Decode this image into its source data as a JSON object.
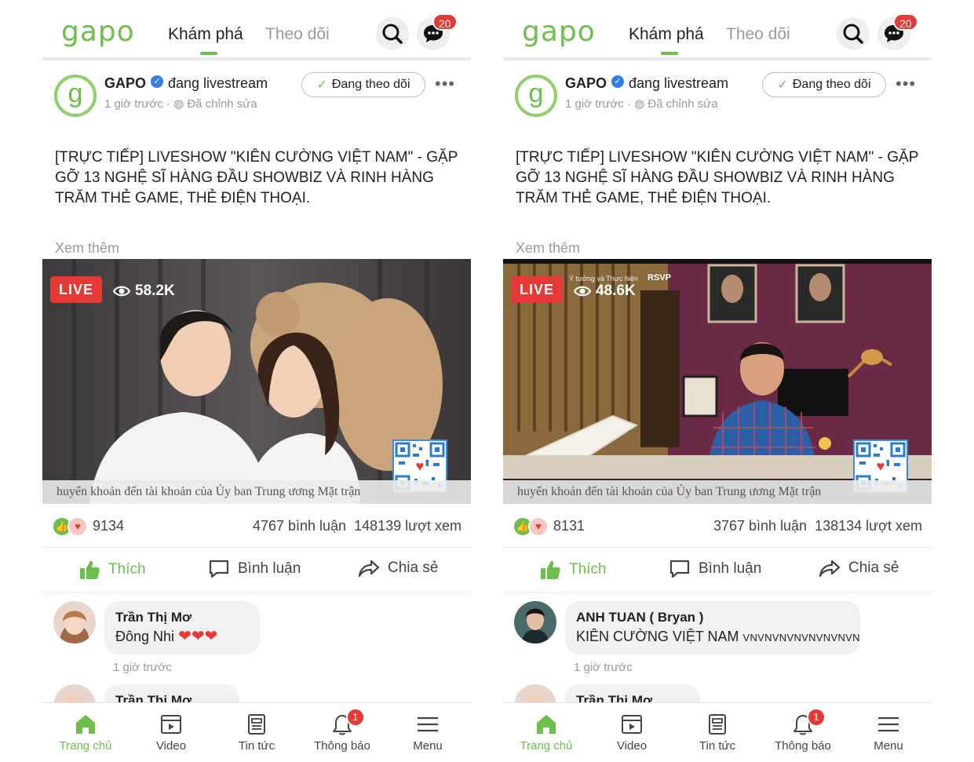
{
  "colors": {
    "brand_green": "#6cc04a",
    "badge_red": "#e53935",
    "muted": "#9a9a9a",
    "verified_blue": "#2f7fe6"
  },
  "screens": [
    {
      "header": {
        "logo": "gapo",
        "tab_active": "Khám phá",
        "tab_inactive": "Theo dõi",
        "chat_badge": "20"
      },
      "post": {
        "author": "GAPO",
        "action": "đang livestream",
        "time": "1 giờ trước · ",
        "edited": "Đã chỉnh sửa",
        "follow_label": "Đang theo dõi",
        "text": "[TRỰC TIẾP] LIVESHOW \"KIÊN CƯỜNG VIỆT NAM\" - GẶP GỠ 13 NGHỆ SĨ HÀNG ĐẦU SHOWBIZ VÀ RINH HÀNG TRĂM THẺ GAME, THẺ ĐIỆN THOẠI.",
        "see_more": "Xem thêm"
      },
      "video": {
        "live_label": "LIVE",
        "viewers": "58.2K",
        "ticker": "huyển khoản đến tài khoản của Ủy ban Trung ương Mặt trận"
      },
      "stats": {
        "likes": "9134",
        "comments": "4767 bình luận",
        "views": "148139 lượt xem"
      },
      "actions": {
        "like": "Thích",
        "comment": "Bình luận",
        "share": "Chia sẻ"
      },
      "comment": {
        "name": "Trần Thị Mơ",
        "text": "Đông Nhi",
        "suffix": "",
        "hearts": "❤❤❤",
        "time": "1 giờ trước"
      },
      "comment2": {
        "name": "Trần Thị Mơ"
      },
      "nav": [
        {
          "label": "Trang chủ"
        },
        {
          "label": "Video"
        },
        {
          "label": "Tin tức"
        },
        {
          "label": "Thông báo",
          "badge": "1"
        },
        {
          "label": "Menu"
        }
      ]
    },
    {
      "header": {
        "logo": "gapo",
        "tab_active": "Khám phá",
        "tab_inactive": "Theo dõi",
        "chat_badge": "20"
      },
      "post": {
        "author": "GAPO",
        "action": "đang livestream",
        "time": "1 giờ trước · ",
        "edited": "Đã chỉnh sửa",
        "follow_label": "Đang theo dõi",
        "text": "[TRỰC TIẾP] LIVESHOW \"KIÊN CƯỜNG VIỆT NAM\" - GẶP GỠ 13 NGHỆ SĨ HÀNG ĐẦU SHOWBIZ VÀ RINH HÀNG TRĂM THẺ GAME, THẺ ĐIỆN THOẠI.",
        "see_more": "Xem thêm"
      },
      "video": {
        "live_label": "LIVE",
        "viewers": "48.6K",
        "ticker": "huyển khoản đến tài khoản của Ủy ban Trung ương Mặt trận",
        "overlay_sponsor": "Ý tưởng và Thực hiện",
        "overlay_logo": "RSVP"
      },
      "stats": {
        "likes": "8131",
        "comments": "3767 bình luận",
        "views": "138134 lượt xem"
      },
      "actions": {
        "like": "Thích",
        "comment": "Bình luận",
        "share": "Chia sẻ"
      },
      "comment": {
        "name": "ANH TUAN ( Bryan )",
        "text": "KIÊN CƯỜNG VIỆT NAM ",
        "suffix": "VNVNVNVNVNVNVNVN",
        "hearts": "",
        "time": "1 giờ trước"
      },
      "comment2": {
        "name": "Trần Thị Mơ"
      },
      "nav": [
        {
          "label": "Trang chủ"
        },
        {
          "label": "Video"
        },
        {
          "label": "Tin tức"
        },
        {
          "label": "Thông báo",
          "badge": "1"
        },
        {
          "label": "Menu"
        }
      ]
    }
  ]
}
